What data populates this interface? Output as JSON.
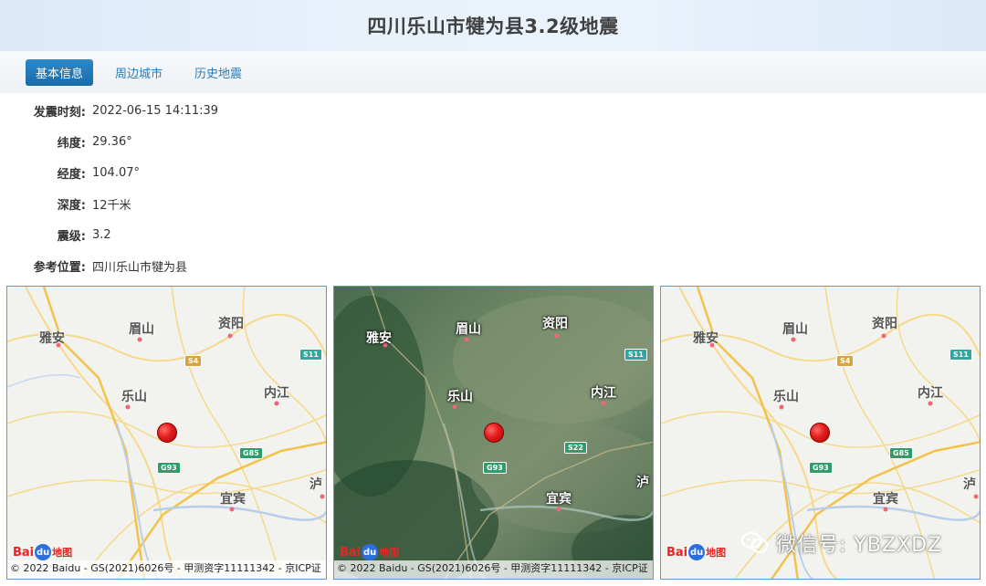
{
  "page": {
    "title": "四川乐山市犍为县3.2级地震"
  },
  "tabs": [
    {
      "label": "基本信息",
      "active": true
    },
    {
      "label": "周边城市",
      "active": false
    },
    {
      "label": "历史地震",
      "active": false
    }
  ],
  "info": {
    "time_label": "发震时刻:",
    "time_value": "2022-06-15 14:11:39",
    "lat_label": "纬度:",
    "lat_value": "29.36°",
    "lon_label": "经度:",
    "lon_value": "104.07°",
    "depth_label": "深度:",
    "depth_value": "12千米",
    "mag_label": "震级:",
    "mag_value": "3.2",
    "loc_label": "参考位置:",
    "loc_value": "四川乐山市犍为县"
  },
  "maps": {
    "cities": {
      "yaan": "雅安",
      "meishan": "眉山",
      "ziyang": "资阳",
      "leshan": "乐山",
      "neijiang": "内江",
      "yibin": "宜宾",
      "lu": "泸"
    },
    "shields": {
      "s11": "S11",
      "s4": "S4",
      "g85": "G85",
      "g93": "G93",
      "s22": "S22"
    },
    "logo": {
      "bai": "Bai",
      "du": "du",
      "dt": "地图"
    },
    "copyright": "© 2022 Baidu - GS(2021)6026号 - 甲测资字11111342 - 京ICP证"
  },
  "watermark": {
    "text": "微信号: YBZXDZ",
    "icon": "wechat-icon"
  },
  "colors": {
    "accent": "#1b6aa8",
    "tab_text": "#2a7ab8",
    "quake_marker": "#e31b1b",
    "map_border": "#5a9bd5"
  }
}
